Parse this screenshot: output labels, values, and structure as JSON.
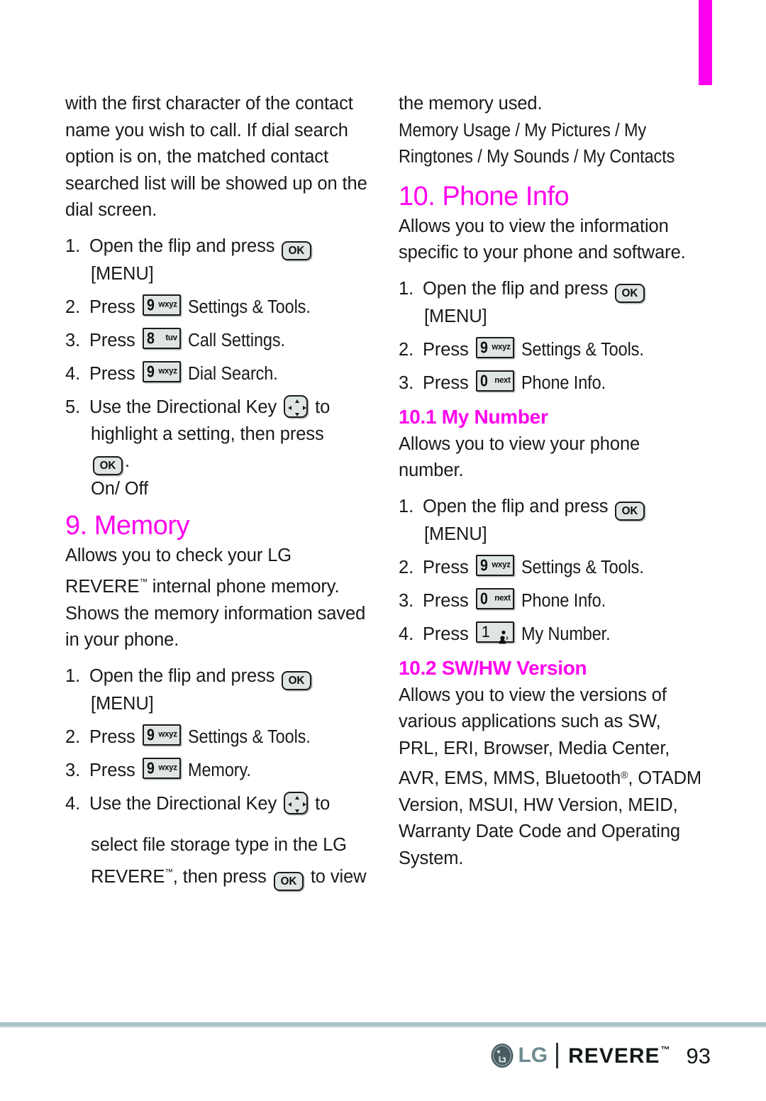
{
  "page": {
    "number": "93",
    "tab_color": "#ff00ee"
  },
  "left_column": {
    "intro_paragraph": "with the first character of the contact name you wish to call. If dial search option is on, the matched contact searched list will be showed up on the dial screen.",
    "dial_search_steps": [
      {
        "num": "1.",
        "text_before": "Open the flip and press",
        "key": "OK",
        "text_after": "",
        "continuation": "[MENU]."
      },
      {
        "num": "2.",
        "text_before": "Press",
        "key": "9 wxyz",
        "text_after": "Settings & Tools."
      },
      {
        "num": "3.",
        "text_before": "Press",
        "key": "8 tuv",
        "text_after": "Call Settings."
      },
      {
        "num": "4.",
        "text_before": "Press",
        "key": "9 wxyz",
        "text_after": "Dial Search."
      },
      {
        "num": "5.",
        "text_before": "Use the Directional Key",
        "key": "Directional",
        "text_after": "to",
        "continuation": "highlight a setting, then press",
        "continuation2_key": "OK",
        "continuation2_after": ".",
        "options": "On/ Off"
      }
    ],
    "memory_heading": "9. Memory",
    "memory_description": "Allows you to check your LG REVERE™ internal phone memory. Shows the memory information saved in your phone.",
    "memory_steps": [
      {
        "num": "1.",
        "text_before": "Open the flip and press",
        "key": "OK",
        "continuation": "[MENU]."
      },
      {
        "num": "2.",
        "text_before": "Press",
        "key": "9 wxyz",
        "text_after": "Settings & Tools."
      },
      {
        "num": "3.",
        "text_before": "Press",
        "key": "9 wxyz",
        "text_after": "Memory."
      },
      {
        "num": "4.",
        "text_before": "Use the Directional Key",
        "key": "Directional",
        "text_after": "to",
        "continuation": "select file storage type in the LG REVERE™, then press",
        "continuation2_key": "OK",
        "continuation2_after": "to view"
      }
    ]
  },
  "right_column": {
    "memory_continued": "the memory used.",
    "memory_items": "Memory Usage / My Pictures / My Ringtones / My Sounds / My Contacts",
    "phone_info_heading": "10. Phone Info",
    "phone_info_description": "Allows you to view the information specific to your phone and software.",
    "phone_info_steps": [
      {
        "num": "1.",
        "text_before": "Open the flip and press",
        "key": "OK",
        "continuation": "[MENU]."
      },
      {
        "num": "2.",
        "text_before": "Press",
        "key": "9 wxyz",
        "text_after": "Settings & Tools."
      },
      {
        "num": "3.",
        "text_before": "Press",
        "key": "0 next",
        "text_after": "Phone Info."
      }
    ],
    "my_number_heading": "10.1 My Number",
    "my_number_description": "Allows you to view your phone number.",
    "my_number_steps": [
      {
        "num": "1.",
        "text_before": "Open the flip and press",
        "key": "OK",
        "continuation": "[MENU]."
      },
      {
        "num": "2.",
        "text_before": "Press",
        "key": "9 wxyz",
        "text_after": "Settings & Tools."
      },
      {
        "num": "3.",
        "text_before": "Press",
        "key": "0 next",
        "text_after": "Phone Info."
      },
      {
        "num": "4.",
        "text_before": "Press",
        "key": "1 voicemail",
        "text_after": "My Number."
      }
    ],
    "sw_hw_heading": "10.2 SW/HW Version",
    "sw_hw_description": "Allows you to view the versions of various applications such as SW, PRL, ERI, Browser, Media Center, AVR, EMS, MMS, Bluetooth®, OTADM Version, MSUI, HW Version, MEID, Warranty Date Code and Operating System."
  },
  "keys": {
    "ok_label": "OK",
    "nine_digit": "9",
    "nine_letters": "wxyz",
    "eight_digit": "8",
    "eight_letters": "tuv",
    "zero_digit": "0",
    "zero_letters": "next",
    "one_digit": "1",
    "menu_label": "[MENU]"
  },
  "footer": {
    "lg_text": "LG",
    "revere_text": "REVERE",
    "trademark": "™",
    "page_number": "93"
  },
  "labels": {
    "press": "Press",
    "open_flip": "Open the flip and press",
    "use_dir_key": "Use the Directional Key",
    "to": "to",
    "settings_tools": "Settings & Tools.",
    "call_settings": "Call Settings.",
    "dial_search": "Dial Search.",
    "memory": "Memory.",
    "phone_info": "Phone Info.",
    "my_number": "My Number.",
    "highlight_setting": "highlight a setting, then press",
    "period": ".",
    "on_off": "On/ Off",
    "select_file_storage_1": "select file storage type in the LG",
    "select_file_storage_2a": "REVERE",
    "select_file_storage_2b": ", then press",
    "to_view": "to view"
  }
}
